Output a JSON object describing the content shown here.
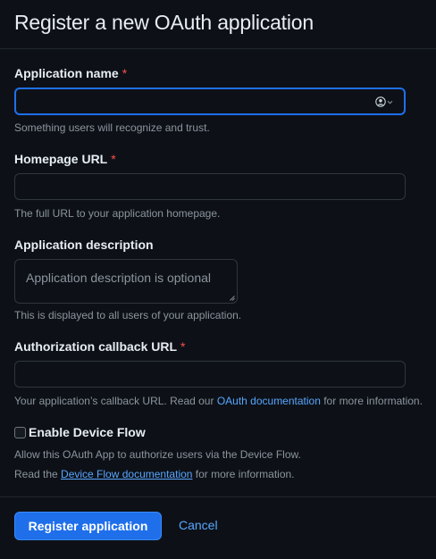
{
  "page": {
    "title": "Register a new OAuth application"
  },
  "form": {
    "app_name": {
      "label": "Application name",
      "required_mark": "*",
      "value": "",
      "hint": "Something users will recognize and trust.",
      "autofill_icon": "person-circle-icon"
    },
    "homepage_url": {
      "label": "Homepage URL",
      "required_mark": "*",
      "value": "",
      "hint": "The full URL to your application homepage."
    },
    "description": {
      "label": "Application description",
      "placeholder": "Application description is optional",
      "hint": "This is displayed to all users of your application."
    },
    "callback_url": {
      "label": "Authorization callback URL",
      "required_mark": "*",
      "value": "",
      "hint_prefix": "Your application’s callback URL. Read our ",
      "hint_link": "OAuth documentation",
      "hint_suffix": " for more information."
    },
    "device_flow": {
      "label": "Enable Device Flow",
      "checked": false,
      "hint_line1": "Allow this OAuth App to authorize users via the Device Flow.",
      "hint_line2_prefix": "Read the ",
      "hint_line2_link": "Device Flow documentation",
      "hint_line2_suffix": " for more information."
    }
  },
  "actions": {
    "submit_label": "Register application",
    "cancel_label": "Cancel"
  },
  "colors": {
    "background": "#0d1117",
    "accent": "#1f6feb",
    "link": "#58a6ff",
    "required": "#f85149"
  }
}
